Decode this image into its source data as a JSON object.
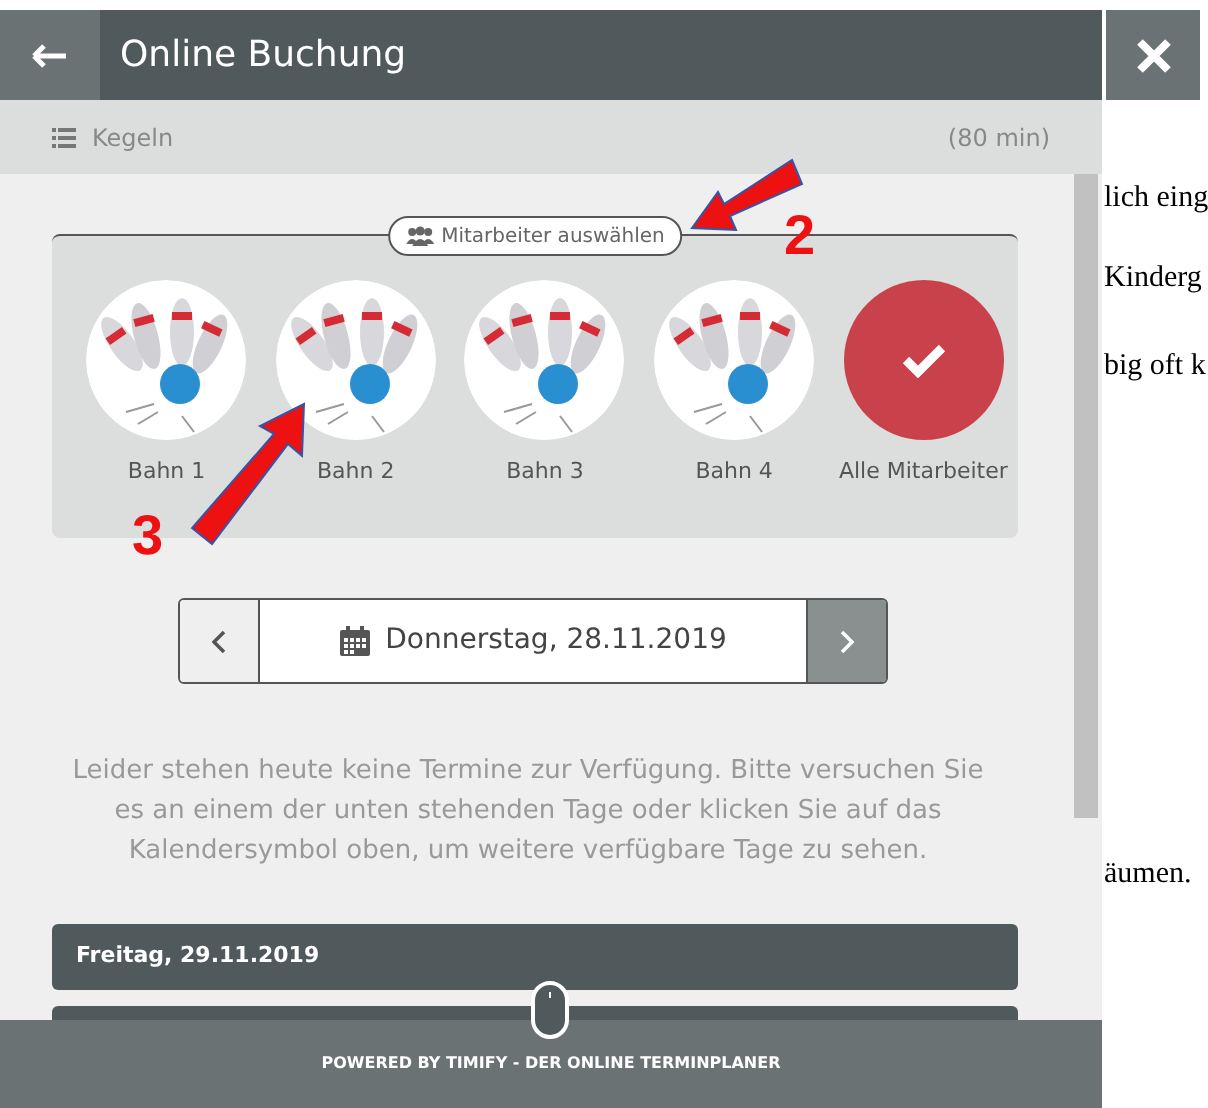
{
  "page_behind": {
    "text_fragments": [
      "lich eing",
      "Kinderg",
      "big oft k",
      "äumen."
    ]
  },
  "header": {
    "title": "Online Buchung"
  },
  "service": {
    "name": "Kegeln",
    "duration": "(80 min)"
  },
  "employees": {
    "label": "Mitarbeiter auswählen",
    "items": [
      {
        "kind": "lane",
        "name": "Bahn 1",
        "selected": false
      },
      {
        "kind": "lane",
        "name": "Bahn 2",
        "selected": false
      },
      {
        "kind": "lane",
        "name": "Bahn 3",
        "selected": false
      },
      {
        "kind": "lane",
        "name": "Bahn 4",
        "selected": false
      },
      {
        "kind": "all",
        "name": "Alle Mitarbeiter",
        "selected": true
      }
    ]
  },
  "date_nav": {
    "date": "Donnerstag, 28.11.2019"
  },
  "message": "Leider stehen heute keine Termine zur Verfügung. Bitte versuchen Sie es an einem der unten stehenden Tage oder klicken Sie auf das Kalendersymbol oben, um weitere verfügbare Tage zu sehen.",
  "days": [
    "Freitag, 29.11.2019"
  ],
  "footer": "POWERED BY TIMIFY - DER ONLINE TERMINPLANER",
  "annotations": [
    {
      "number": "2"
    },
    {
      "number": "3"
    }
  ]
}
